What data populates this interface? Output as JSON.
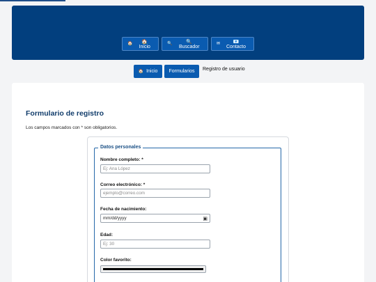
{
  "nav": {
    "items": [
      {
        "icon": "🏠",
        "label": "🏠 Inicio"
      },
      {
        "icon": "🔍",
        "label": "🔍 Buscador"
      },
      {
        "icon": "✉",
        "label": "📧 Contacto"
      }
    ]
  },
  "breadcrumb": {
    "items": [
      {
        "icon": "🏠",
        "label": "Inicio"
      },
      {
        "label": "Formularios"
      }
    ],
    "current": "Registro de usuario"
  },
  "page": {
    "title": "Formulario de registro",
    "intro": "Los campos marcados con * son obligatorios."
  },
  "form": {
    "legend": "Datos personales",
    "fields": [
      {
        "label": "Nombre completo: *",
        "placeholder": "Ej: Ana López"
      },
      {
        "label": "Correo electrónico: *",
        "placeholder": "ejemplo@correo.com"
      },
      {
        "label": "Fecha de nacimiento:",
        "placeholder": "mm/dd/yyyy"
      },
      {
        "label": "Edad:",
        "placeholder": "Ej: 30"
      },
      {
        "label": "Color favorito:",
        "value": "#000000"
      }
    ]
  },
  "colors": {
    "banner": "#023f7e",
    "button": "#0a5bb0",
    "title": "#123d6b"
  }
}
